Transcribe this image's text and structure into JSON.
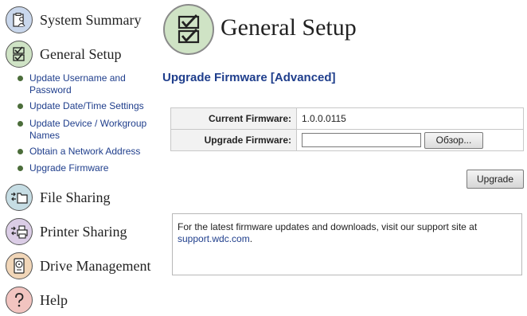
{
  "sidebar": {
    "system_summary": "System Summary",
    "general_setup": "General Setup",
    "sub_items": [
      {
        "label": "Update Username and Password"
      },
      {
        "label": "Update Date/Time Settings"
      },
      {
        "label": "Update Device / Workgroup Names"
      },
      {
        "label": "Obtain a Network Address"
      },
      {
        "label": "Upgrade Firmware"
      }
    ],
    "file_sharing": "File Sharing",
    "printer_sharing": "Printer Sharing",
    "drive_management": "Drive Management",
    "help": "Help"
  },
  "header": {
    "title": "General Setup"
  },
  "section": {
    "title": "Upgrade Firmware [Advanced]"
  },
  "firmware": {
    "current_label": "Current Firmware:",
    "current_value": "1.0.0.0115",
    "upgrade_label": "Upgrade Firmware:",
    "file_value": "",
    "browse_label": "Обзор..."
  },
  "actions": {
    "upgrade_label": "Upgrade"
  },
  "info": {
    "text": "For the latest firmware updates and downloads, visit our support site at",
    "link": "support.wdc.com",
    "suffix": "."
  },
  "colors": {
    "link": "#1f3e8c",
    "bullet": "#4b6d3a",
    "general_setup_icon_bg": "#cfe3c5"
  },
  "icons": {
    "system_summary": "clipboard-person-icon",
    "general_setup": "checkbox-icon",
    "file_sharing": "folder-arrows-icon",
    "printer_sharing": "printer-arrows-icon",
    "drive_management": "hard-drive-icon",
    "help": "question-mark-icon"
  }
}
